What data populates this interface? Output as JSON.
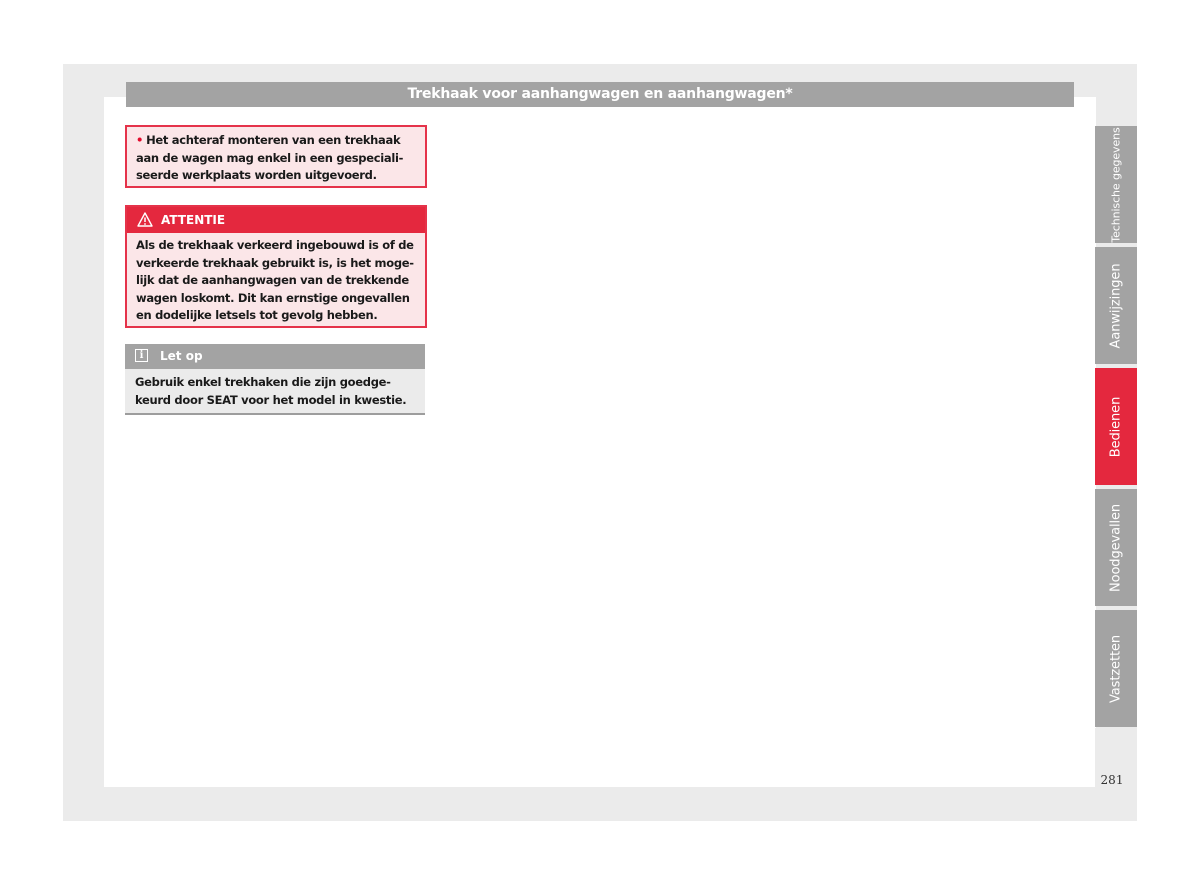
{
  "header": {
    "title": "Trekhaak voor aanhangwagen en aanhangwagen*"
  },
  "note": {
    "bullet": "•",
    "text": "Het achteraf monteren van een trekhaak aan de wagen mag enkel in een gespeciali­seerde werkplaats worden uitgevoerd."
  },
  "warning": {
    "icon": "warning-triangle-icon",
    "label": "ATTENTIE",
    "text": "Als de trekhaak verkeerd ingebouwd is of de verkeerde trekhaak gebruikt is, is het moge­lijk dat de aanhangwagen van de trekkende wagen loskomt. Dit kan ernstige ongevallen en dodelijke letsels tot gevolg hebben."
  },
  "info": {
    "icon": "info-icon",
    "label": "Let op",
    "text": "Gebruik enkel trekhaken die zijn goedge­keurd door SEAT voor het model in kwestie."
  },
  "side_tabs": [
    {
      "label": "Technische gegevens",
      "active": false
    },
    {
      "label": "Aanwijzingen",
      "active": false
    },
    {
      "label": "Bedienen",
      "active": true
    },
    {
      "label": "Noodgevallen",
      "active": false
    },
    {
      "label": "Vastzetten",
      "active": false
    }
  ],
  "page_number": "281",
  "colors": {
    "accent_red": "#e4283e",
    "header_gray": "#a3a3a3",
    "note_bg": "#fbe6e8",
    "info_bg": "#ebebeb"
  }
}
